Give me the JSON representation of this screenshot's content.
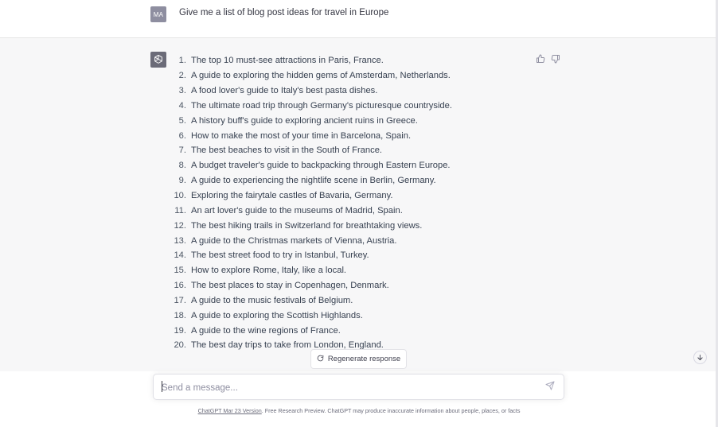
{
  "user_message": {
    "avatar_initials": "MA",
    "text": "Give me a list of blog post ideas for travel in Europe"
  },
  "assistant_message": {
    "avatar_icon": "openai-logo-icon",
    "items": [
      {
        "num": "1.",
        "text": "The top 10 must-see attractions in Paris, France."
      },
      {
        "num": "2.",
        "text": "A guide to exploring the hidden gems of Amsterdam, Netherlands."
      },
      {
        "num": "3.",
        "text": "A food lover's guide to Italy's best pasta dishes."
      },
      {
        "num": "4.",
        "text": "The ultimate road trip through Germany's picturesque countryside."
      },
      {
        "num": "5.",
        "text": "A history buff's guide to exploring ancient ruins in Greece."
      },
      {
        "num": "6.",
        "text": "How to make the most of your time in Barcelona, Spain."
      },
      {
        "num": "7.",
        "text": "The best beaches to visit in the South of France."
      },
      {
        "num": "8.",
        "text": "A budget traveler's guide to backpacking through Eastern Europe."
      },
      {
        "num": "9.",
        "text": "A guide to experiencing the nightlife scene in Berlin, Germany."
      },
      {
        "num": "10.",
        "text": "Exploring the fairytale castles of Bavaria, Germany."
      },
      {
        "num": "11.",
        "text": "An art lover's guide to the museums of Madrid, Spain."
      },
      {
        "num": "12.",
        "text": "The best hiking trails in Switzerland for breathtaking views."
      },
      {
        "num": "13.",
        "text": "A guide to the Christmas markets of Vienna, Austria."
      },
      {
        "num": "14.",
        "text": "The best street food to try in Istanbul, Turkey."
      },
      {
        "num": "15.",
        "text": "How to explore Rome, Italy, like a local."
      },
      {
        "num": "16.",
        "text": "The best places to stay in Copenhagen, Denmark."
      },
      {
        "num": "17.",
        "text": "A guide to the music festivals of Belgium."
      },
      {
        "num": "18.",
        "text": "A guide to exploring the Scottish Highlands."
      },
      {
        "num": "19.",
        "text": "A guide to the wine regions of France."
      },
      {
        "num": "20.",
        "text": "The best day trips to take from London, England."
      }
    ]
  },
  "actions": {
    "regenerate_label": "Regenerate response"
  },
  "composer": {
    "placeholder": "Send a message..."
  },
  "footer": {
    "link_text": "ChatGPT Mar 23 Version",
    "rest_text": ". Free Research Preview. ChatGPT may produce inaccurate information about people, places, or facts"
  },
  "colors": {
    "assistant_bg": "#f7f7f8",
    "user_bg": "#ffffff",
    "text": "#343541"
  }
}
